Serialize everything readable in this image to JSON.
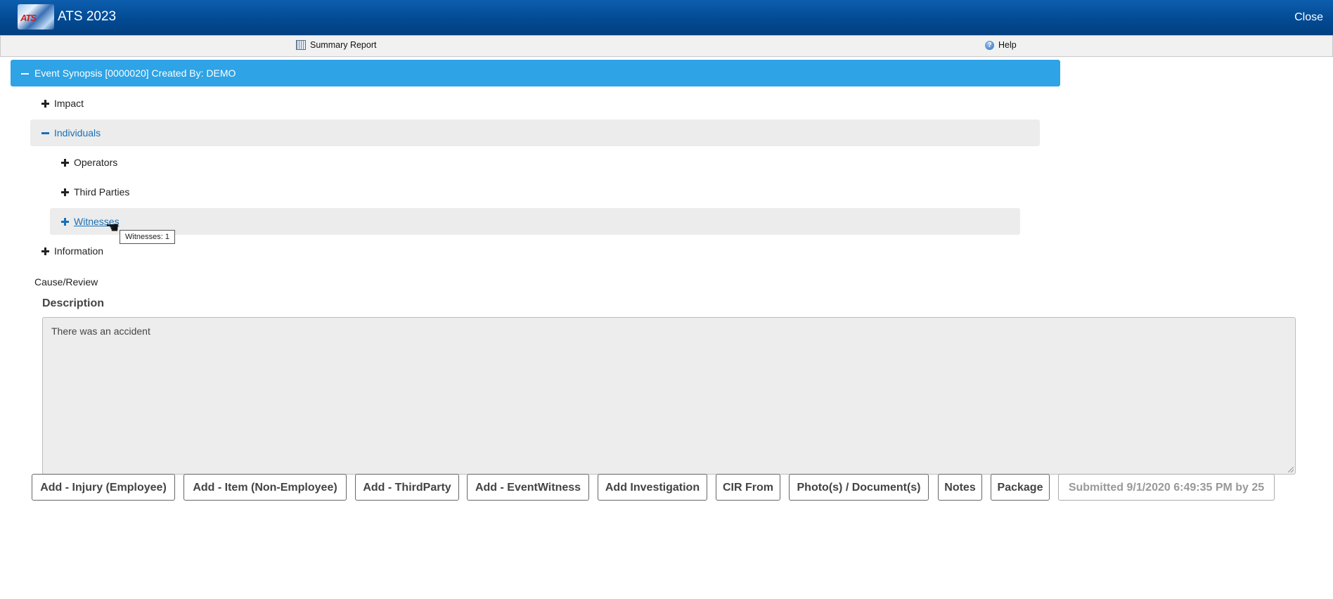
{
  "app": {
    "title": "ATS 2023",
    "logo_text": "ATS",
    "close_label": "Close"
  },
  "toolbar": {
    "summary_report": "Summary Report",
    "help": "Help"
  },
  "synopsis": {
    "header": "Event Synopsis [0000020] Created By: DEMO"
  },
  "tree": {
    "impact": "Impact",
    "individuals": "Individuals",
    "operators": "Operators",
    "third_parties": "Third Parties",
    "witnesses": "Witnesses",
    "information": "Information"
  },
  "tooltip": {
    "text": "Witnesses: 1"
  },
  "cause_review": {
    "label": "Cause/Review"
  },
  "description": {
    "label": "Description",
    "value": "There was an accident"
  },
  "actions": {
    "add_injury": "Add - Injury (Employee)",
    "add_item": "Add - Item (Non-Employee)",
    "add_thirdparty": "Add - ThirdParty",
    "add_eventwitness": "Add - EventWitness",
    "add_investigation": "Add Investigation",
    "cir_from": "CIR From",
    "photos_documents": "Photo(s) / Document(s)",
    "notes": "Notes",
    "package": "Package",
    "submitted": "Submitted 9/1/2020 6:49:35 PM by 25"
  }
}
